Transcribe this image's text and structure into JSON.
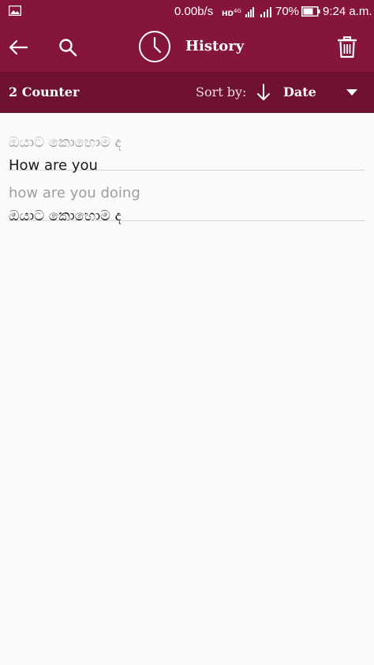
{
  "status_bar": {
    "network_speed": "0.00b/s",
    "network_type": "4G",
    "hd_label": "HD",
    "battery": "70%",
    "time": "9:24 a.m."
  },
  "app_bar": {
    "title": "History",
    "icons": [
      "back-arrow",
      "search",
      "history-clock",
      "trash"
    ]
  },
  "sub_bar": {
    "counter": "2 Counter",
    "sort_label": "Sort by:",
    "sort_value": "Date"
  },
  "history": [
    {
      "source": "ඔයාට කොහොම ද",
      "target": "How are you"
    },
    {
      "source": "how are you doing",
      "target": "ඔයාට කොහොම ද"
    }
  ],
  "colors": {
    "primary": "#85163a",
    "primary_dark": "#6f1230",
    "background": "#fafafa",
    "secondary_text": "#9e9e9e",
    "primary_text": "#1a1a1a",
    "divider": "#d6d6d6"
  }
}
